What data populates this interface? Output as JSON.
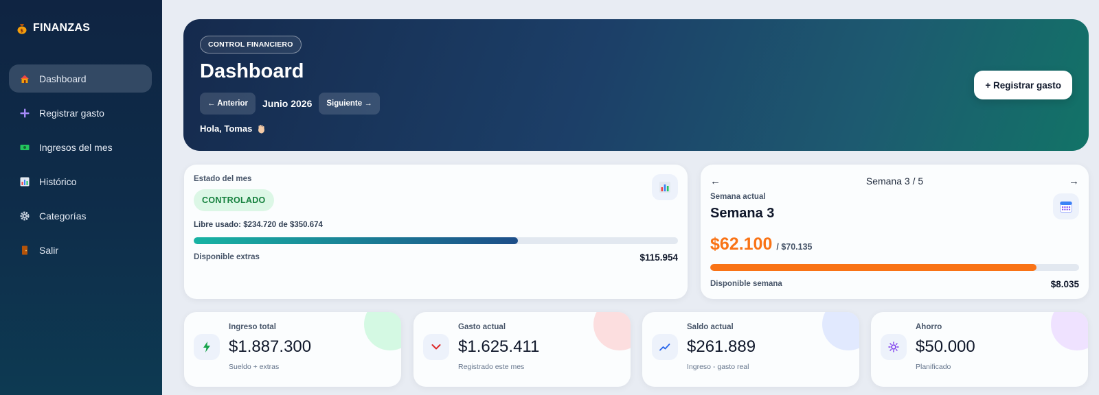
{
  "sidebar": {
    "brand": "FINANZAS",
    "items": [
      {
        "label": "Dashboard",
        "icon": "house-icon",
        "active": true
      },
      {
        "label": "Registrar gasto",
        "icon": "plus-icon",
        "active": false
      },
      {
        "label": "Ingresos del mes",
        "icon": "money-icon",
        "active": false
      },
      {
        "label": "Histórico",
        "icon": "chart-icon",
        "active": false
      },
      {
        "label": "Categorías",
        "icon": "gear-icon",
        "active": false
      },
      {
        "label": "Salir",
        "icon": "door-icon",
        "active": false
      }
    ]
  },
  "hero": {
    "pill": "CONTROL FINANCIERO",
    "title": "Dashboard",
    "prev_label": "← Anterior",
    "month": "Junio 2026",
    "next_label": "Siguiente →",
    "greeting": "Hola, Tomas",
    "register_button": "+ Registrar gasto"
  },
  "status": {
    "title": "Estado del mes",
    "badge": "CONTROLADO",
    "used_label": "Libre usado: $234.720 de $350.674",
    "progress": 0.669,
    "available_label": "Disponible extras",
    "available_value": "$115.954"
  },
  "week": {
    "nav_label": "Semana 3 / 5",
    "prev_arrow": "←",
    "next_arrow": "→",
    "current_label": "Semana actual",
    "title": "Semana 3",
    "amount": "$62.100",
    "of": "/ $70.135",
    "progress": 0.885,
    "available_label": "Disponible semana",
    "available_value": "$8.035"
  },
  "stats": [
    {
      "label": "Ingreso total",
      "value": "$1.887.300",
      "sub": "Sueldo + extras",
      "icon": "bolt-icon",
      "accent": "#bbf7d0"
    },
    {
      "label": "Gasto actual",
      "value": "$1.625.411",
      "sub": "Registrado este mes",
      "icon": "chevron-down-icon",
      "accent": "#fecaca"
    },
    {
      "label": "Saldo actual",
      "value": "$261.889",
      "sub": "Ingreso - gasto real",
      "icon": "trend-up-icon",
      "accent": "#dbe4fe"
    },
    {
      "label": "Ahorro",
      "value": "$50.000",
      "sub": "Planificado",
      "icon": "sparkle-icon",
      "accent": "#e9d5ff"
    }
  ],
  "colors": {
    "accent_orange": "#f97316",
    "accent_teal": "#17b3a3",
    "badge_green": "#15803d"
  }
}
